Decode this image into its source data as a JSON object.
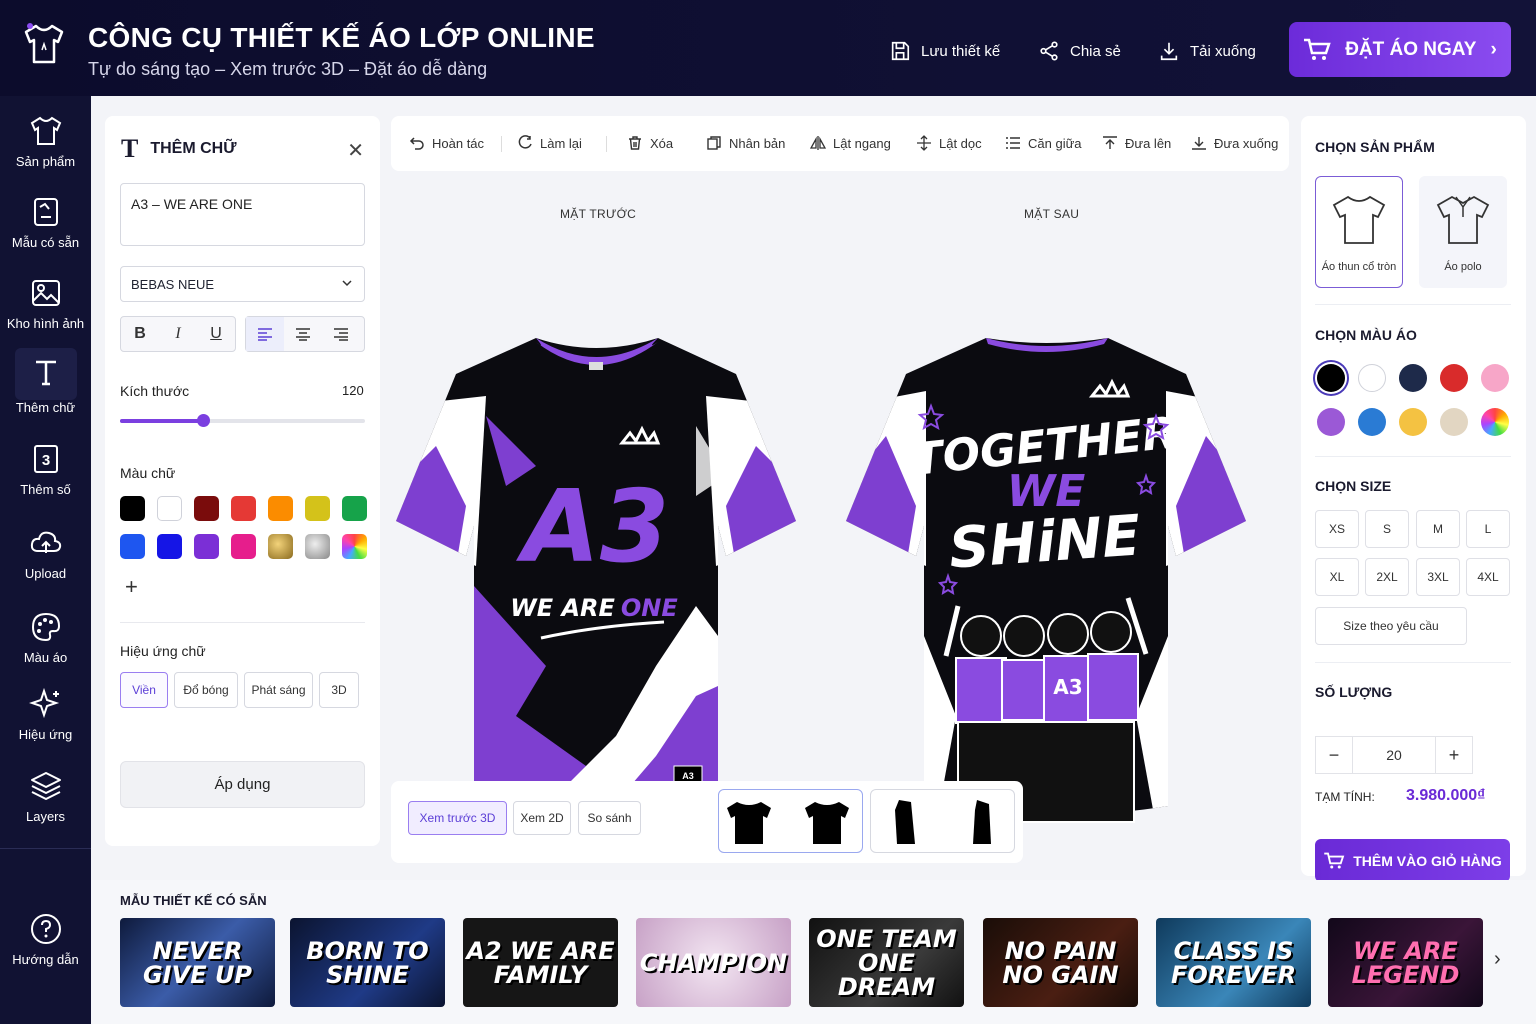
{
  "header": {
    "title": "CÔNG CỤ THIẾT KẾ ÁO LỚP ONLINE",
    "subtitle": "Tự do sáng tạo – Xem trước 3D – Đặt áo dễ dàng",
    "save": "Lưu thiết kế",
    "share": "Chia sẻ",
    "download": "Tải xuống",
    "order": "ĐẶT ÁO NGAY"
  },
  "sidebar": {
    "items": [
      {
        "label": "Sản phẩm",
        "icon": "tshirt-icon"
      },
      {
        "label": "Mẫu có sẵn",
        "icon": "template-icon"
      },
      {
        "label": "Kho hình ảnh",
        "icon": "image-icon"
      },
      {
        "label": "Thêm chữ",
        "icon": "text-icon"
      },
      {
        "label": "Thêm số",
        "icon": "number-icon"
      },
      {
        "label": "Upload",
        "icon": "upload-icon"
      },
      {
        "label": "Màu áo",
        "icon": "palette-icon"
      },
      {
        "label": "Hiệu ứng",
        "icon": "sparkle-icon"
      },
      {
        "label": "Layers",
        "icon": "layers-icon"
      }
    ],
    "help": "Hướng dẫn",
    "number_glyph": "3"
  },
  "text_panel": {
    "title": "THÊM CHỮ",
    "text_value": "A3 – WE ARE ONE",
    "font": "BEBAS NEUE",
    "bold": "B",
    "italic": "I",
    "underline": "U",
    "size_label": "Kích thước",
    "size_value": "120",
    "size_fraction": 0.34,
    "color_label": "Màu chữ",
    "colors": [
      "#000000",
      "#ffffff",
      "#7a0c0c",
      "#e53935",
      "#fb8c00",
      "#d4c21a",
      "#16a34a",
      "#1e56f0",
      "#1515e6",
      "#7b2fd6",
      "#e61e8c",
      "gold-texture",
      "silver-texture",
      "rainbow"
    ],
    "effect_label": "Hiệu ứng chữ",
    "effects": [
      "Viền",
      "Đổ bóng",
      "Phát sáng",
      "3D"
    ],
    "apply": "Áp dụng"
  },
  "toolbar": {
    "undo": "Hoàn tác",
    "redo": "Làm lại",
    "delete": "Xóa",
    "duplicate": "Nhân bản",
    "flip_h": "Lật ngang",
    "flip_v": "Lật dọc",
    "center": "Căn giữa",
    "bring_up": "Đưa lên",
    "send_down": "Đưa xuống"
  },
  "canvas": {
    "front_label": "MẶT TRƯỚC",
    "back_label": "MẶT SAU",
    "front_big": "A3",
    "front_slogan_a": "WE ARE",
    "front_slogan_b": "ONE",
    "back_line1": "TOGETHER",
    "back_line2": "WE",
    "back_line3": "SHiNE",
    "back_shirt_text": "A3",
    "tag_text": "A3"
  },
  "view_modes": [
    "Xem trước 3D",
    "Xem 2D",
    "So sánh"
  ],
  "product_panel": {
    "choose_product": "CHỌN SẢN PHẨM",
    "products": [
      "Áo thun cổ tròn",
      "Áo polo"
    ],
    "choose_color": "CHỌN MÀU ÁO",
    "shirt_colors": [
      "#000000",
      "#ffffff",
      "#1e2a4a",
      "#d92b2b",
      "#f7a6c8",
      "#9b59d6",
      "#2a7bd4",
      "#f4c242",
      "#e2d6c2",
      "rainbow"
    ],
    "choose_size": "CHỌN SIZE",
    "sizes": [
      "XS",
      "S",
      "M",
      "L",
      "XL",
      "2XL",
      "3XL",
      "4XL"
    ],
    "custom_size": "Size theo yêu cầu",
    "quantity_label": "SỐ LƯỢNG",
    "quantity": "20",
    "minus": "−",
    "plus": "+",
    "subtotal_label": "TẠM TÍNH:",
    "subtotal": "3.980.000₫",
    "add_to_cart": "THÊM VÀO GIỎ HÀNG"
  },
  "templates": {
    "title": "MẪU THIẾT KẾ CÓ SẴN",
    "items": [
      "NEVER GIVE UP",
      "BORN TO SHINE",
      "A2 WE ARE FAMILY",
      "CHAMPION",
      "ONE TEAM ONE DREAM",
      "NO PAIN NO GAIN",
      "CLASS IS FOREVER",
      "WE ARE LEGEND"
    ]
  },
  "colors": {
    "accent": "#7b3fe0",
    "header_bg": "#0c0c2c",
    "shirt_purple": "#7e3fd0"
  }
}
